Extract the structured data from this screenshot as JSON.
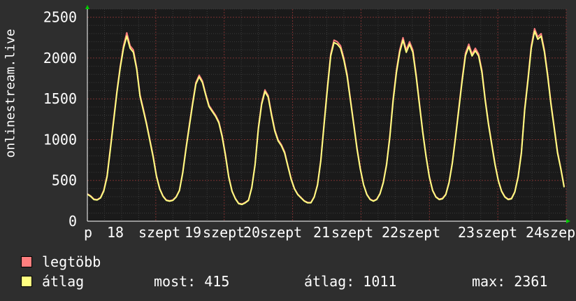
{
  "chart_data": {
    "type": "line",
    "ylabel": "onlinestream.live",
    "ylim": [
      0,
      2600
    ],
    "yticks": [
      0,
      500,
      1000,
      1500,
      2000,
      2500
    ],
    "x_tick_labels": [
      "p",
      "18",
      "szept",
      "19",
      "szept",
      "20",
      "szept",
      "21",
      "szept",
      "22",
      "szept",
      "23",
      "szept",
      "24",
      "szep"
    ],
    "series": [
      {
        "name": "legtöbb",
        "color": "#ff7f7f",
        "values": [
          335,
          310,
          270,
          265,
          290,
          380,
          560,
          900,
          1250,
          1600,
          1900,
          2150,
          2310,
          2150,
          2100,
          1880,
          1550,
          1380,
          1200,
          1000,
          800,
          560,
          400,
          310,
          260,
          250,
          260,
          300,
          380,
          600,
          900,
          1180,
          1450,
          1700,
          1790,
          1720,
          1560,
          1420,
          1360,
          1300,
          1220,
          1050,
          820,
          550,
          370,
          280,
          220,
          210,
          230,
          260,
          420,
          700,
          1150,
          1450,
          1610,
          1540,
          1320,
          1120,
          1000,
          940,
          850,
          680,
          520,
          400,
          330,
          290,
          250,
          230,
          230,
          300,
          450,
          750,
          1200,
          1650,
          2050,
          2220,
          2200,
          2150,
          2000,
          1800,
          1500,
          1200,
          900,
          650,
          450,
          330,
          270,
          250,
          270,
          340,
          480,
          700,
          1050,
          1500,
          1850,
          2100,
          2250,
          2100,
          2200,
          2100,
          1800,
          1450,
          1100,
          800,
          550,
          380,
          300,
          270,
          280,
          330,
          480,
          720,
          1050,
          1400,
          1750,
          2060,
          2170,
          2050,
          2120,
          2050,
          1850,
          1500,
          1200,
          950,
          700,
          500,
          370,
          300,
          270,
          280,
          360,
          550,
          850,
          1380,
          1750,
          2150,
          2361,
          2260,
          2300,
          2100,
          1800,
          1450,
          1150,
          850,
          650,
          430
        ]
      },
      {
        "name": "átlag",
        "color": "#ffff80",
        "values": [
          330,
          305,
          265,
          260,
          285,
          370,
          545,
          880,
          1230,
          1580,
          1880,
          2120,
          2270,
          2120,
          2070,
          1860,
          1530,
          1360,
          1185,
          985,
          785,
          550,
          395,
          305,
          255,
          245,
          255,
          295,
          375,
          590,
          885,
          1160,
          1430,
          1680,
          1770,
          1700,
          1545,
          1405,
          1345,
          1285,
          1205,
          1035,
          805,
          540,
          365,
          275,
          215,
          205,
          225,
          255,
          410,
          690,
          1130,
          1430,
          1590,
          1520,
          1300,
          1105,
          985,
          925,
          835,
          670,
          510,
          395,
          325,
          285,
          245,
          225,
          225,
          295,
          440,
          735,
          1180,
          1625,
          2025,
          2190,
          2170,
          2120,
          1975,
          1775,
          1480,
          1185,
          885,
          640,
          445,
          325,
          265,
          245,
          265,
          335,
          470,
          690,
          1030,
          1475,
          1820,
          2070,
          2220,
          2070,
          2170,
          2070,
          1775,
          1430,
          1085,
          790,
          540,
          375,
          295,
          265,
          275,
          325,
          470,
          710,
          1035,
          1380,
          1725,
          2030,
          2140,
          2025,
          2090,
          2025,
          1825,
          1480,
          1185,
          935,
          690,
          495,
          365,
          295,
          265,
          275,
          355,
          540,
          835,
          1360,
          1725,
          2120,
          2330,
          2230,
          2270,
          2075,
          1775,
          1430,
          1135,
          835,
          640,
          415
        ]
      }
    ]
  },
  "legend": [
    {
      "label": "legtöbb",
      "color": "#ff7f7f"
    },
    {
      "label": "átlag",
      "color": "#ffff80"
    }
  ],
  "stats": {
    "current": "most: 415",
    "average": "átlag: 1011",
    "max": "max: 2361"
  }
}
